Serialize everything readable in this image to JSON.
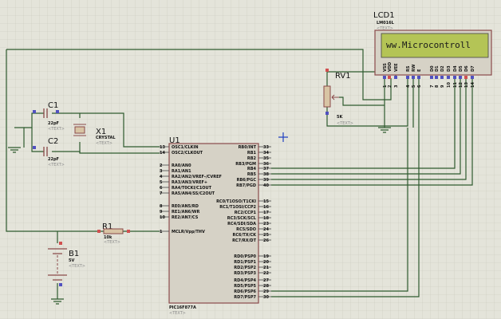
{
  "colors": {
    "wire": "#2e5a2e",
    "lcd_screen": "#b4c456",
    "component_outline": "#8a4a4a",
    "grid": "#c8c8bc"
  },
  "placeholder_text": "<TEXT>",
  "lcd": {
    "ref": "LCD1",
    "part": "LM016L",
    "display_text": "ww.Microcontroll",
    "pins": [
      {
        "n": "1",
        "name": "VSS"
      },
      {
        "n": "2",
        "name": "VDD"
      },
      {
        "n": "3",
        "name": "VEE"
      },
      {
        "n": "4",
        "name": "RS"
      },
      {
        "n": "5",
        "name": "RW"
      },
      {
        "n": "6",
        "name": "E"
      },
      {
        "n": "7",
        "name": "D0"
      },
      {
        "n": "8",
        "name": "D1"
      },
      {
        "n": "9",
        "name": "D2"
      },
      {
        "n": "10",
        "name": "D3"
      },
      {
        "n": "11",
        "name": "D4"
      },
      {
        "n": "12",
        "name": "D5"
      },
      {
        "n": "13",
        "name": "D6"
      },
      {
        "n": "14",
        "name": "D7"
      }
    ]
  },
  "rv1": {
    "ref": "RV1",
    "value": "5K"
  },
  "c1": {
    "ref": "C1",
    "value": "22pF"
  },
  "c2": {
    "ref": "C2",
    "value": "22pF"
  },
  "x1": {
    "ref": "X1",
    "value": "CRYSTAL"
  },
  "r1": {
    "ref": "R1",
    "value": "10k"
  },
  "b1": {
    "ref": "B1",
    "value": "5V"
  },
  "u1": {
    "ref": "U1",
    "part": "PIC16F877A",
    "left_pins": [
      {
        "n": "13",
        "name": "OSC1/CLKIN"
      },
      {
        "n": "14",
        "name": "OSC2/CLKOUT"
      },
      {
        "n": "2",
        "name": "RA0/AN0"
      },
      {
        "n": "3",
        "name": "RA1/AN1"
      },
      {
        "n": "4",
        "name": "RA2/AN2/VREF-/CVREF"
      },
      {
        "n": "5",
        "name": "RA3/AN3/VREF+"
      },
      {
        "n": "6",
        "name": "RA4/T0CKI/C1OUT"
      },
      {
        "n": "7",
        "name": "RA5/AN4/SS/C2OUT"
      },
      {
        "n": "8",
        "name": "RE0/AN5/RD"
      },
      {
        "n": "9",
        "name": "RE1/AN6/WR"
      },
      {
        "n": "10",
        "name": "RE2/AN7/CS"
      },
      {
        "n": "1",
        "name": "MCLR/Vpp/THV"
      }
    ],
    "right_pins": [
      {
        "n": "33",
        "name": "RB0/INT"
      },
      {
        "n": "34",
        "name": "RB1"
      },
      {
        "n": "35",
        "name": "RB2"
      },
      {
        "n": "36",
        "name": "RB3/PGM"
      },
      {
        "n": "37",
        "name": "RB4"
      },
      {
        "n": "38",
        "name": "RB5"
      },
      {
        "n": "39",
        "name": "RB6/PGC"
      },
      {
        "n": "40",
        "name": "RB7/PGD"
      },
      {
        "n": "15",
        "name": "RC0/T1OSO/T1CKI"
      },
      {
        "n": "16",
        "name": "RC1/T1OSI/CCP2"
      },
      {
        "n": "17",
        "name": "RC2/CCP1"
      },
      {
        "n": "18",
        "name": "RC3/SCK/SCL"
      },
      {
        "n": "23",
        "name": "RC4/SDI/SDA"
      },
      {
        "n": "24",
        "name": "RC5/SDO"
      },
      {
        "n": "25",
        "name": "RC6/TX/CK"
      },
      {
        "n": "26",
        "name": "RC7/RX/DT"
      },
      {
        "n": "19",
        "name": "RD0/PSP0"
      },
      {
        "n": "20",
        "name": "RD1/PSP1"
      },
      {
        "n": "21",
        "name": "RD2/PSP2"
      },
      {
        "n": "22",
        "name": "RD3/PSP3"
      },
      {
        "n": "27",
        "name": "RD4/PSP4"
      },
      {
        "n": "28",
        "name": "RD5/PSP5"
      },
      {
        "n": "29",
        "name": "RD6/PSP6"
      },
      {
        "n": "30",
        "name": "RD7/PSP7"
      }
    ]
  }
}
